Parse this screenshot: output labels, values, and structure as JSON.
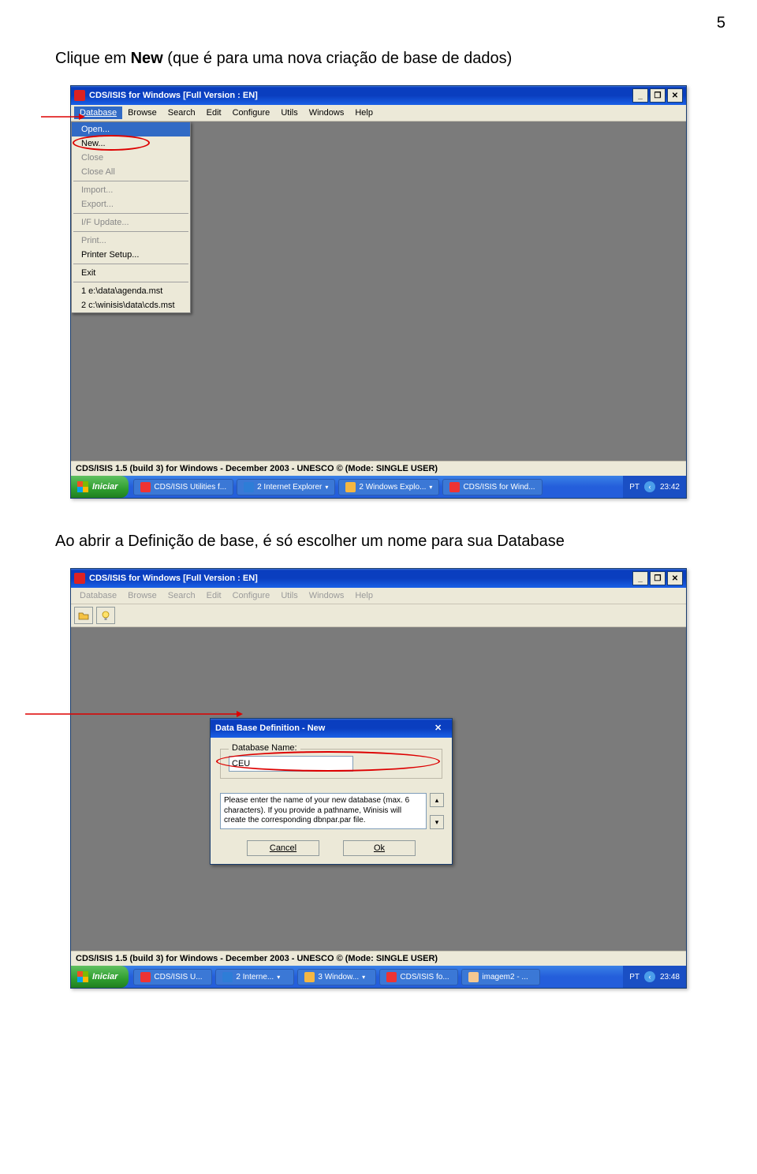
{
  "page": {
    "number": "5"
  },
  "paragraphs": {
    "p1_a": "Clique em ",
    "p1_b": "New",
    "p1_c": " (que é para uma nova criação de base de dados)",
    "p2": "Ao abrir a Definição de base, é só escolher um nome para sua Database"
  },
  "win1": {
    "title": "CDS/ISIS for Windows [Full Version : EN]",
    "menubar": [
      "Database",
      "Browse",
      "Search",
      "Edit",
      "Configure",
      "Utils",
      "Windows",
      "Help"
    ],
    "dropdown": [
      "Open...",
      "New...",
      "Close",
      "Close All",
      "Import...",
      "Export...",
      "I/F Update...",
      "Print...",
      "Printer Setup...",
      "Exit",
      "1 e:\\data\\agenda.mst",
      "2 c:\\winisis\\data\\cds.mst"
    ],
    "status": "CDS/ISIS 1.5 (build 3) for Windows - December 2003 - UNESCO © (Mode: SINGLE USER)",
    "taskbar": {
      "start": "Iniciar",
      "tasks": [
        "CDS/ISIS Utilities f...",
        "2 Internet Explorer",
        "2 Windows Explo...",
        "CDS/ISIS for Wind..."
      ],
      "lang": "PT",
      "time": "23:42"
    }
  },
  "win2": {
    "title": "CDS/ISIS for Windows [Full Version : EN]",
    "menubar": [
      "Database",
      "Browse",
      "Search",
      "Edit",
      "Configure",
      "Utils",
      "Windows",
      "Help"
    ],
    "dialog": {
      "title": "Data Base Definition - New",
      "field_label": "Database Name:",
      "field_value": "CEU",
      "help_text": "Please enter the name of your new database (max. 6 characters). If you provide a pathname, Winisis will create the corresponding dbnpar.par file.",
      "cancel": "Cancel",
      "ok": "Ok"
    },
    "status": "CDS/ISIS 1.5 (build 3) for Windows - December 2003 - UNESCO © (Mode: SINGLE USER)",
    "taskbar": {
      "start": "Iniciar",
      "tasks": [
        "CDS/ISIS U...",
        "2 Interne...",
        "3 Window...",
        "CDS/ISIS fo...",
        "imagem2 - ..."
      ],
      "lang": "PT",
      "time": "23:48"
    }
  }
}
